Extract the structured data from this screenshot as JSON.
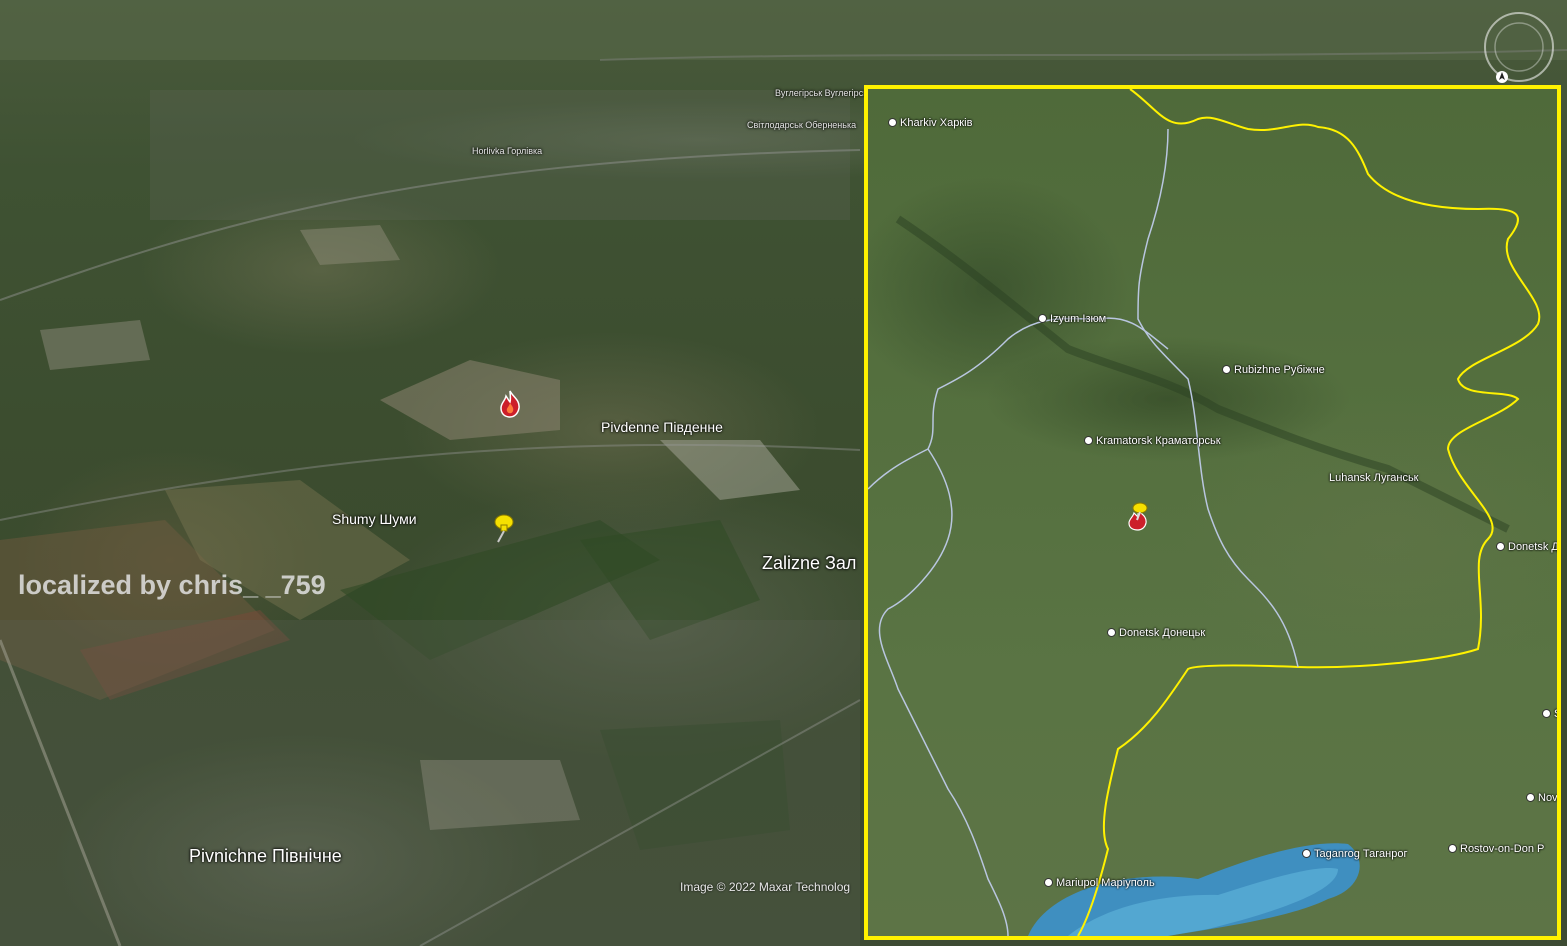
{
  "satellite_view": {
    "labels": {
      "horlivka": "Horlivka Горлівка",
      "north_top_1": "Вуглегірськ Вуглегірськ",
      "north_top_2": "Світлодарськ Оберненька",
      "pivdenne": "Pivdenne Південне",
      "shumy": "Shumy Шуми",
      "zalizne": "Zalizne Зал",
      "pivnichne": "Pivnichne Північне"
    },
    "watermark": "localized by chris_ _759",
    "credit": "Image © 2022 Maxar Technolog",
    "icons": [
      "fire-icon",
      "pushpin-icon",
      "compass-icon"
    ],
    "colors": {
      "pin": "#f5e000",
      "fire": "#cc1f2a"
    }
  },
  "inset_map": {
    "border_color": "#fff200",
    "cities": {
      "kharkiv": "Kharkiv Харків",
      "izyum": "Izyum Ізюм",
      "rubizhne": "Rubizhne Рубіжне",
      "kramatorsk": "Kramatorsk Краматорськ",
      "luhansk": "Luhansk Луганськ",
      "donetsk_ru": "Donetsk Д",
      "donetsk": "Donetsk Донецьк",
      "s_edge": "S",
      "novo": "Novo",
      "taganrog": "Taganrog Таганрог",
      "rostov": "Rostov-on-Don Р",
      "mariupol": "Mariupol Маріуполь"
    }
  }
}
